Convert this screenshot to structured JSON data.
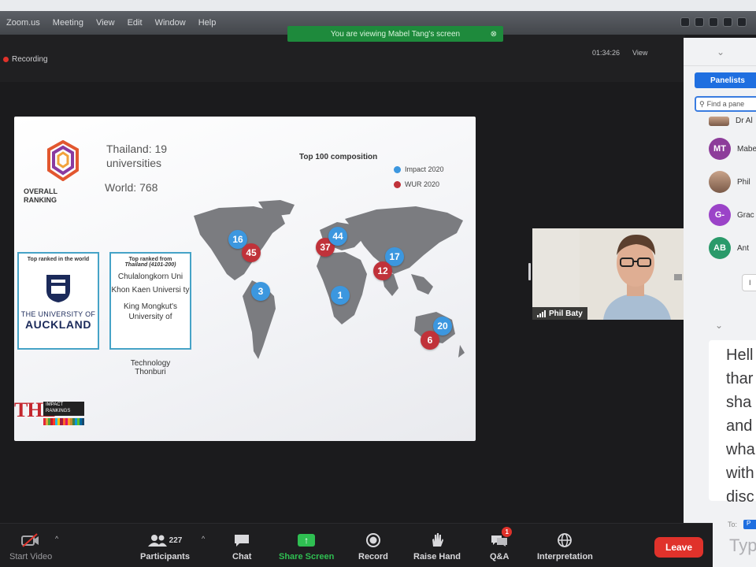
{
  "menubar": {
    "items": [
      "Zoom.us",
      "Meeting",
      "View",
      "Edit",
      "Window",
      "Help"
    ]
  },
  "banner": {
    "text": "You are viewing Mabel Tang's screen",
    "close_glyph": "⊗"
  },
  "recording": {
    "label": "Recording"
  },
  "view_options": {
    "time": "01:34:26",
    "view_label": "View"
  },
  "slide": {
    "overall_ranking": "OVERALL RANKING",
    "thailand_line": "Thailand: 19 universities",
    "world_line": "World: 768",
    "composition_title": "Top 100 composition",
    "legend": [
      {
        "label": "Impact 2020",
        "color": "#3c97df"
      },
      {
        "label": "WUR 2020",
        "color": "#c0323a"
      }
    ],
    "pins": [
      {
        "value": "16",
        "type": "blue"
      },
      {
        "value": "45",
        "type": "red"
      },
      {
        "value": "37",
        "type": "red"
      },
      {
        "value": "44",
        "type": "blue"
      },
      {
        "value": "17",
        "type": "blue"
      },
      {
        "value": "12",
        "type": "red"
      },
      {
        "value": "3",
        "type": "blue"
      },
      {
        "value": "1",
        "type": "blue"
      },
      {
        "value": "20",
        "type": "blue"
      },
      {
        "value": "6",
        "type": "red"
      }
    ],
    "box_world": {
      "heading": "Top ranked in the world",
      "uni_prefix": "THE UNIVERSITY OF",
      "uni_name": "AUCKLAND"
    },
    "box_thailand": {
      "heading": "Top ranked from",
      "subheading": "Thailand (4101-200)",
      "uni1": "Chulalongkorn Uni",
      "uni2": "Khon Kaen Universi ty",
      "uni3": "King Mongkut's University of",
      "uni3_cont": "Technology Thonburi"
    },
    "the_logo": {
      "mark": "THE",
      "caption": "IMPACT RANKINGS"
    }
  },
  "video": {
    "participant_name": "Phil Baty"
  },
  "panel": {
    "tab_label": "Panelists",
    "search_placeholder": "Find a pane",
    "participants": [
      {
        "initials": "",
        "name": "Dr Al",
        "color": "#a7866f"
      },
      {
        "initials": "MT",
        "name": "Mabe",
        "color": "#8d3d9a"
      },
      {
        "initials": "",
        "name": "Phil",
        "color": "#b58a6d"
      },
      {
        "initials": "G-",
        "name": "Grac",
        "color": "#9b43c8"
      },
      {
        "initials": "AB",
        "name": "Ant",
        "color": "#2a9a6a"
      }
    ],
    "invite_label": "I",
    "chat_lines": [
      "Hell",
      "thar",
      "sha",
      "and",
      "wha",
      "with",
      "disc"
    ],
    "to_label": "To:",
    "to_button": "P",
    "type_placeholder": "Typ"
  },
  "toolbar": {
    "start_video": "Start Video",
    "participants": "Participants",
    "participant_count": "227",
    "chat": "Chat",
    "share_screen": "Share Screen",
    "record": "Record",
    "raise_hand": "Raise Hand",
    "qa": "Q&A",
    "qa_badge": "1",
    "interpretation": "Interpretation",
    "leave": "Leave"
  },
  "colors": {
    "share_green": "#2fbf52",
    "leave_red": "#e0322b",
    "banner_green": "#1e8a3c",
    "panel_blue": "#1f6fe0"
  }
}
